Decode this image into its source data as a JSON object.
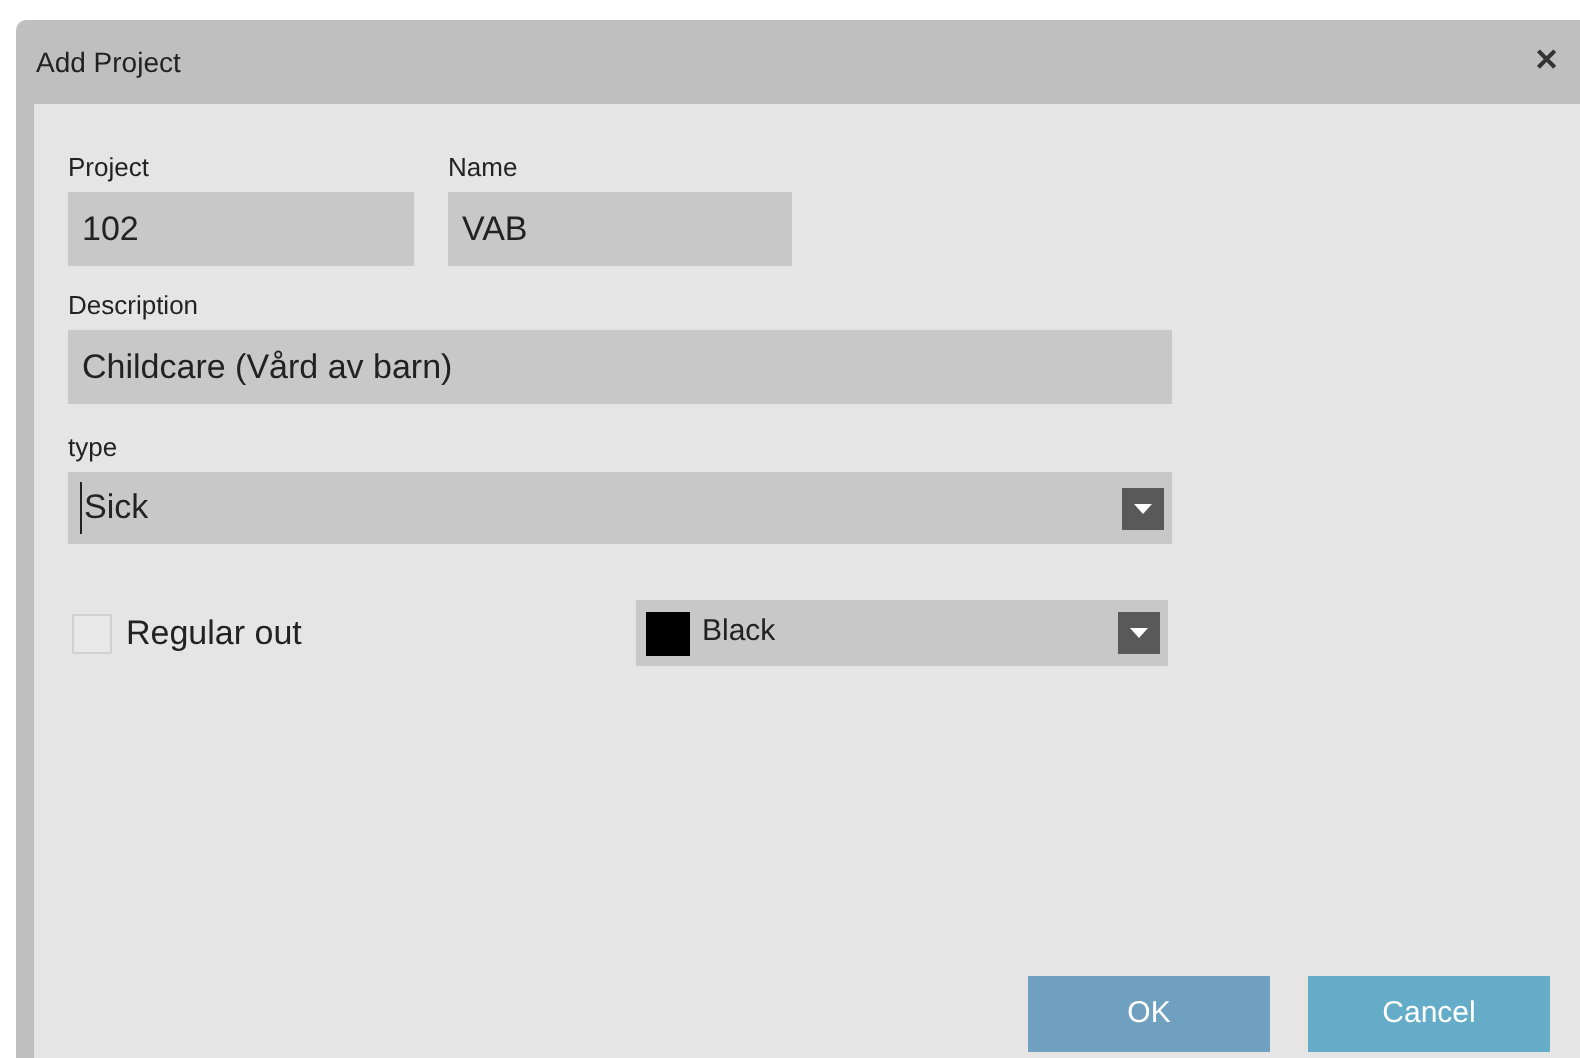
{
  "window": {
    "title": "Add Project",
    "close": "✕"
  },
  "fields": [
    {
      "label": "Project",
      "value": "102"
    },
    {
      "label": "Name",
      "value": "VAB"
    },
    {
      "label": "Description",
      "value": "Childcare (Vård av barn)"
    }
  ],
  "type_select": {
    "label": "type",
    "value": "Sick"
  },
  "regular_out": {
    "label": "Regular out",
    "checked": false
  },
  "color_select": {
    "value": "Black",
    "color": "#000000"
  },
  "buttons": [
    {
      "label": "OK",
      "kind": "primary"
    },
    {
      "label": "Cancel",
      "kind": "secondary"
    }
  ]
}
